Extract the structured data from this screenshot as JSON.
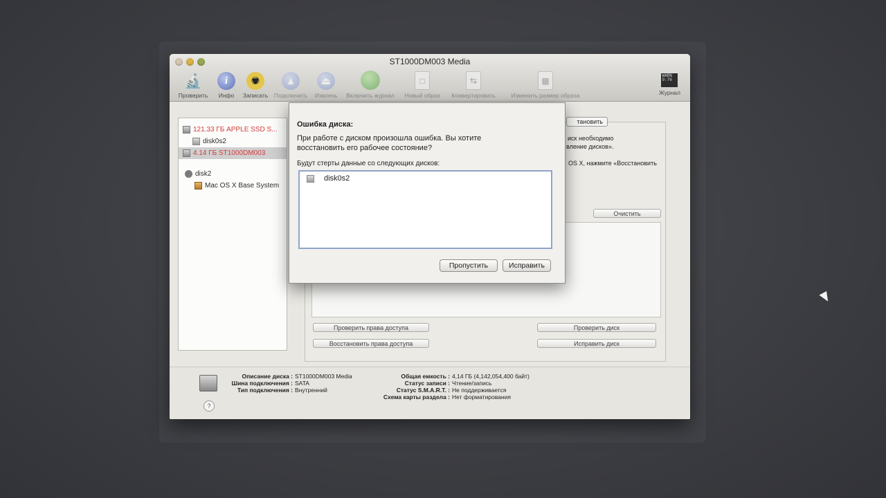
{
  "window": {
    "title": "ST1000DM003 Media"
  },
  "toolbar": {
    "items": [
      {
        "label": "Проверить",
        "icon": "microscope-icon"
      },
      {
        "label": "Инфо",
        "icon": "info-icon"
      },
      {
        "label": "Записать",
        "icon": "burn-icon"
      },
      {
        "label": "Подключить",
        "icon": "mount-icon"
      },
      {
        "label": "Извлечь",
        "icon": "eject-icon"
      },
      {
        "label": "Включить журнал",
        "icon": "enable-journaling-icon"
      },
      {
        "label": "Новый образ",
        "icon": "new-image-icon"
      },
      {
        "label": "Конвертировать",
        "icon": "convert-icon"
      },
      {
        "label": "Изменить размер образа",
        "icon": "resize-image-icon"
      }
    ],
    "log": {
      "label": "Журнал",
      "icon": "log-icon",
      "box_text": "WARN 9:76"
    }
  },
  "sidebar": {
    "items": [
      {
        "label": "121.33 ГБ APPLE SSD S...",
        "type": "disk",
        "color": "#d13b3b"
      },
      {
        "label": "disk0s2",
        "type": "volume"
      },
      {
        "label": "4.14 ГБ ST1000DM003",
        "type": "disk",
        "color": "#d13b3b",
        "selected": true
      },
      {
        "label": "disk2",
        "type": "image"
      },
      {
        "label": "Mac OS X Base System",
        "type": "volume"
      }
    ]
  },
  "background_panel": {
    "restore_button": "тановить",
    "text_line1": "иск необходимо",
    "text_line2": "вление дисков».",
    "text_line3": "OS X, нажмите «Восстановить",
    "clear_button": "Очистить",
    "verify_permissions": "Проверить права доступа",
    "repair_permissions": "Восстановить права доступа",
    "verify_disk": "Проверить диск",
    "repair_disk": "Исправить диск"
  },
  "info": {
    "left": [
      {
        "key": "Описание диска :",
        "value": "ST1000DM003 Media"
      },
      {
        "key": "Шина подключения :",
        "value": "SATA"
      },
      {
        "key": "Тип подключения :",
        "value": "Внутренний"
      }
    ],
    "right": [
      {
        "key": "Общая емкость :",
        "value": "4,14 ГБ (4,142,054,400 байт)"
      },
      {
        "key": "Статус записи :",
        "value": "Чтение/запись"
      },
      {
        "key": "Статус S.M.A.R.T. :",
        "value": "Не поддерживается"
      },
      {
        "key": "Схема карты раздела :",
        "value": "Нет форматирования"
      }
    ],
    "help": "?"
  },
  "dialog": {
    "title": "Ошибка диска:",
    "message": "При работе с диском произошла ошибка. Вы хотите восстановить его рабочее состояние?",
    "sublabel": "Будут стерты данные со следующих дисков:",
    "disks": [
      "disk0s2"
    ],
    "skip_button": "Пропустить",
    "repair_button": "Исправить"
  }
}
